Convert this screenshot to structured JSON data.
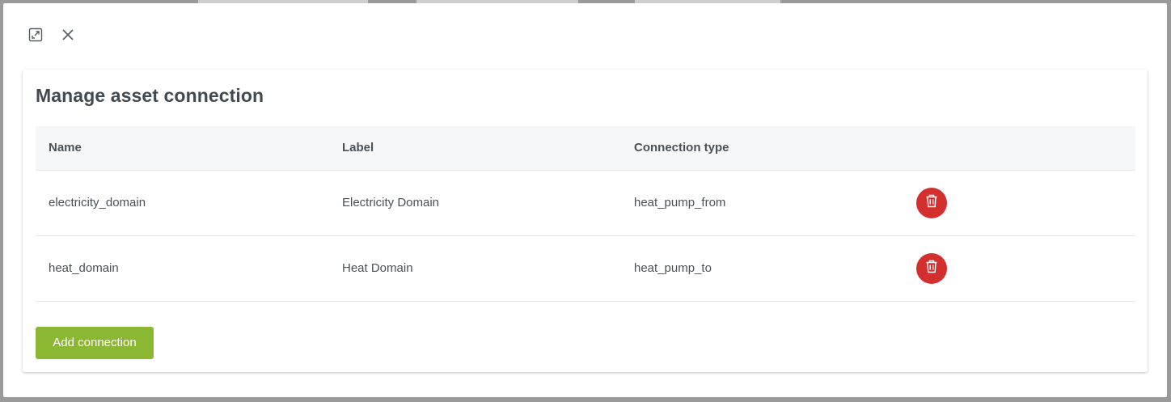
{
  "dialog": {
    "title": "Manage asset connection",
    "icons": {
      "expand": "expand-icon",
      "close": "close-icon",
      "delete": "trash-icon"
    }
  },
  "table": {
    "headers": {
      "name": "Name",
      "label": "Label",
      "connection_type": "Connection type"
    },
    "rows": [
      {
        "name": "electricity_domain",
        "label": "Electricity Domain",
        "connection_type": "heat_pump_from"
      },
      {
        "name": "heat_domain",
        "label": "Heat Domain",
        "connection_type": "heat_pump_to"
      }
    ]
  },
  "actions": {
    "add_label": "Add connection"
  },
  "colors": {
    "add_button": "#8cb733",
    "delete_button": "#d32f2f",
    "header_bg": "#f6f7f8",
    "text": "#4a5157"
  }
}
